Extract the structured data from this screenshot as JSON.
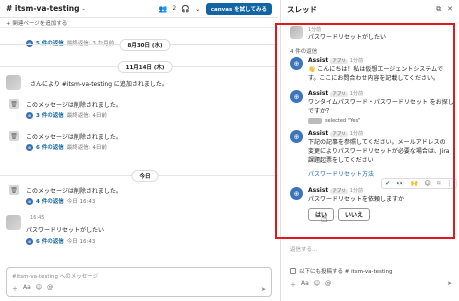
{
  "channel": {
    "title": "# itsm-va-testing",
    "caret": "⌄",
    "member_count": "2",
    "canvas_button": "canvas を試してみる",
    "bookmark": "+ 関連ページを追加する"
  },
  "messages": {
    "reply1": {
      "link": "5 件の返信",
      "meta": "最終返信: 3 か月前"
    },
    "date1": "8月30日 (水)",
    "date2": "11月14日 (木)",
    "join_text": "さんにより #itsm-va-testing に追加されました。",
    "deleted1": "このメッセージは削除されました。",
    "reply2": {
      "link": "3 件の返信",
      "meta": "最終返信: 4日前"
    },
    "deleted2": "このメッセージは削除されました。",
    "reply3": {
      "link": "6 件の返信",
      "meta": "最終返信: 4日前"
    },
    "date3": "今日",
    "deleted3": "このメッセージは削除されました。",
    "reply4": {
      "link": "4 件の返信",
      "meta": "今日 16:43"
    },
    "last_time": "16:45",
    "last_text": "パスワードリセットがしたい",
    "reply5": {
      "link": "6 件の返信",
      "meta": "今日 16:43"
    },
    "composer_placeholder": "#itsm-va-testing へのメッセージ"
  },
  "thread": {
    "title": "スレッド",
    "root": {
      "meta": "1分前",
      "text": "パスワードリセットがしたい"
    },
    "replies_count": "4 件の返信",
    "bot1": {
      "name": "Assist",
      "app": "アプリ",
      "meta": "1分前",
      "line1": "👋 こんにちは！私は仮想エージェントシステムで",
      "line2": "す。ここにお問合わせ内容を記載してください。"
    },
    "bot2": {
      "name": "Assist",
      "app": "アプリ",
      "meta": "1分前",
      "line1": "ワンタイムパスワード・パスワードリセット をお探し",
      "line2": "ですか？",
      "selected": "selected \"Yes\""
    },
    "bot3": {
      "name": "Assist",
      "app": "アプリ",
      "meta": "1分前",
      "line1": "下記の記事を参照してください。メールアドレスの",
      "line2": "変更によりパスワードリセットが必要な場合は、Jira",
      "line3": "課題起票をしてください",
      "link": "パスワードリセット方法"
    },
    "bot4": {
      "name": "Assist",
      "app": "アプリ",
      "meta": "1分前",
      "text": "パスワードリセットを依頼しますか"
    },
    "yes_button": "はい",
    "no_button": "いいえ",
    "reply_placeholder": "返信する...",
    "also_send": "以下にも投稿する # itsm-va-testing"
  },
  "colors": {
    "accent": "#1264a3",
    "highlight": "#e0191f",
    "bot": "#3b74b8"
  }
}
